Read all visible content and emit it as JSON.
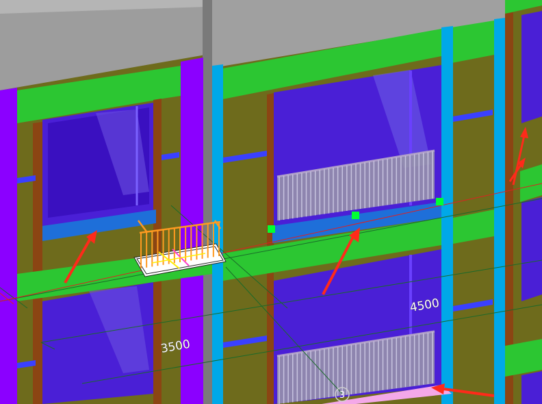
{
  "viewport": {
    "colors": {
      "slab": "#9a9a9a",
      "beam_green": "#2cc632",
      "wall_olive": "#6e6b1c",
      "wall_brown": "#8b4513",
      "column_purple": "#8b00ff",
      "column_cyan": "#00a8e8",
      "glass": "#4a1fd6",
      "sill_blue": "#1e6fd9",
      "railing_gray": "#8d8a9c",
      "selected_railing": "#ff9a20",
      "arrow_red": "#ff2a1a",
      "grip_green": "#00ff33",
      "grid_line": "#1a7a2a",
      "section_line": "#e02020",
      "floor_pink": "#f4a8e8"
    },
    "dimensions": [
      {
        "id": "dim-left",
        "text": "3500"
      },
      {
        "id": "dim-right",
        "text": "4500"
      }
    ],
    "grid_bubble": {
      "label": "3"
    },
    "annotations": [
      {
        "id": "arrow-left-sill",
        "icon": "red-arrow-icon"
      },
      {
        "id": "arrow-center-sill",
        "icon": "red-arrow-icon"
      },
      {
        "id": "arrow-right-upper",
        "icon": "red-arrow-icon"
      },
      {
        "id": "arrow-right-upper-2",
        "icon": "red-arrow-icon"
      },
      {
        "id": "arrow-bottom",
        "icon": "red-arrow-icon"
      }
    ]
  }
}
